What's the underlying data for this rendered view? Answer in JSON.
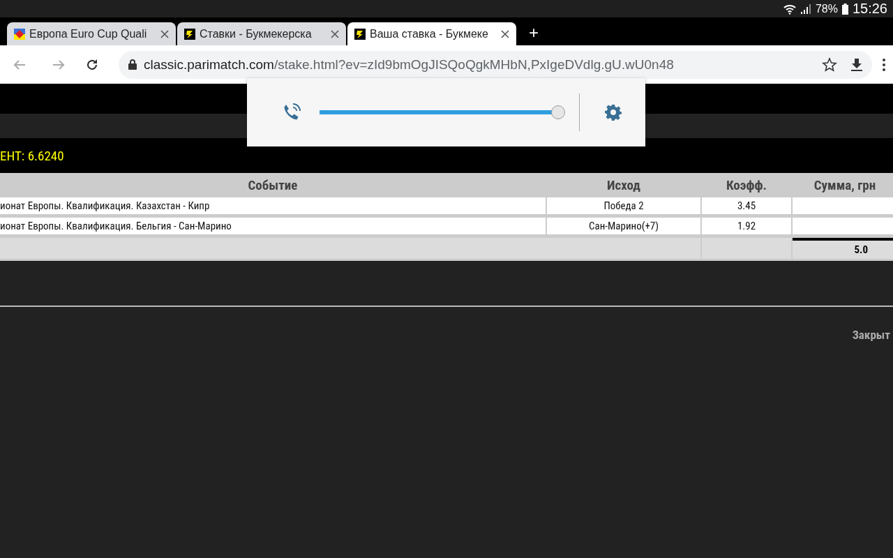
{
  "status_bar": {
    "battery": "78%",
    "time": "15:26"
  },
  "tabs": [
    {
      "title": "Европа Euro Cup Quali",
      "selected": false
    },
    {
      "title": "Ставки - Букмекерска",
      "selected": false
    },
    {
      "title": "Ваша ставка - Букмеке",
      "selected": true
    }
  ],
  "new_tab": "+",
  "address_bar": {
    "host": "classic.parimatch.com",
    "path": "/stake.html?ev=zId9bmOgJISQoQgkMHbN,PxIgeDVdlg.gU.wU0n48"
  },
  "volume_popup": {
    "level": 1
  },
  "coefficient": "ЕНТ: 6.6240",
  "table": {
    "columns": [
      "Событие",
      "Исход",
      "Коэфф.",
      "Сумма, грн"
    ],
    "rows": [
      [
        "ионат Европы. Квалификация. Казахстан - Кипр",
        "Победа 2",
        "3.45",
        ""
      ],
      [
        "ионат Европы. Квалификация. Бельгия - Сан-Марино",
        "Сан-Марино(+7)",
        "1.92",
        ""
      ]
    ],
    "total": "5.0"
  },
  "close_link": "Закрыт"
}
